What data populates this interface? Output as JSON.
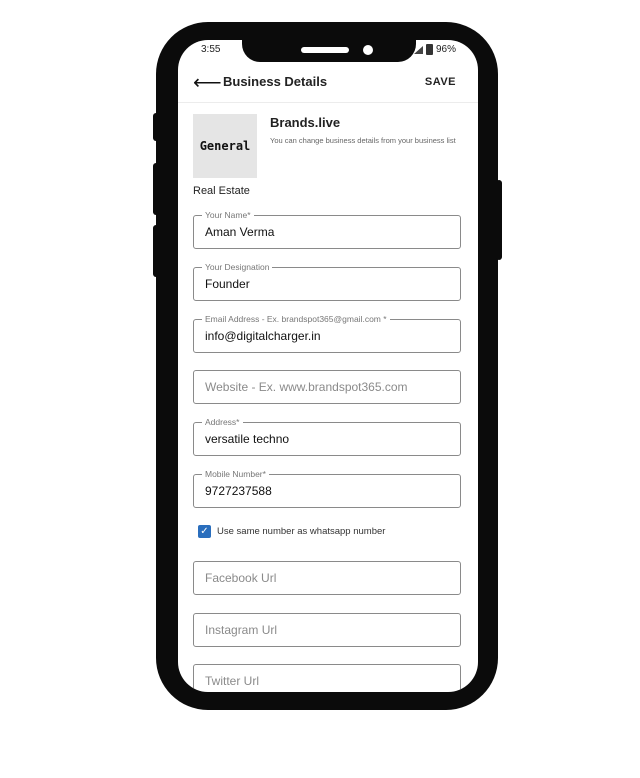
{
  "status_bar": {
    "time": "3:55",
    "battery": "96%"
  },
  "app_bar": {
    "back_icon": "arrow-left-icon",
    "title": "Business Details",
    "save_label": "SAVE"
  },
  "business": {
    "logo_text": "General",
    "name": "Brands.live",
    "subtitle": "You can change business details from your business list",
    "category": "Real Estate"
  },
  "form": {
    "name": {
      "label": "Your Name*",
      "value": "Aman Verma"
    },
    "designation": {
      "label": "Your Designation",
      "value": "Founder"
    },
    "email": {
      "label": "Email Address - Ex. brandspot365@gmail.com *",
      "value": "info@digitalcharger.in"
    },
    "website": {
      "placeholder": "Website - Ex. www.brandspot365.com"
    },
    "address": {
      "label": "Address*",
      "value": "versatile techno"
    },
    "mobile": {
      "label": "Mobile Number*",
      "value": "9727237588"
    },
    "whatsapp_same": {
      "label": "Use same number as whatsapp number",
      "checked": true
    },
    "facebook": {
      "placeholder": "Facebook Url"
    },
    "instagram": {
      "placeholder": "Instagram Url"
    },
    "twitter": {
      "placeholder": "Twitter Url"
    }
  },
  "colors": {
    "checkbox": "#2a6ebd",
    "border": "#8a8a8a"
  }
}
